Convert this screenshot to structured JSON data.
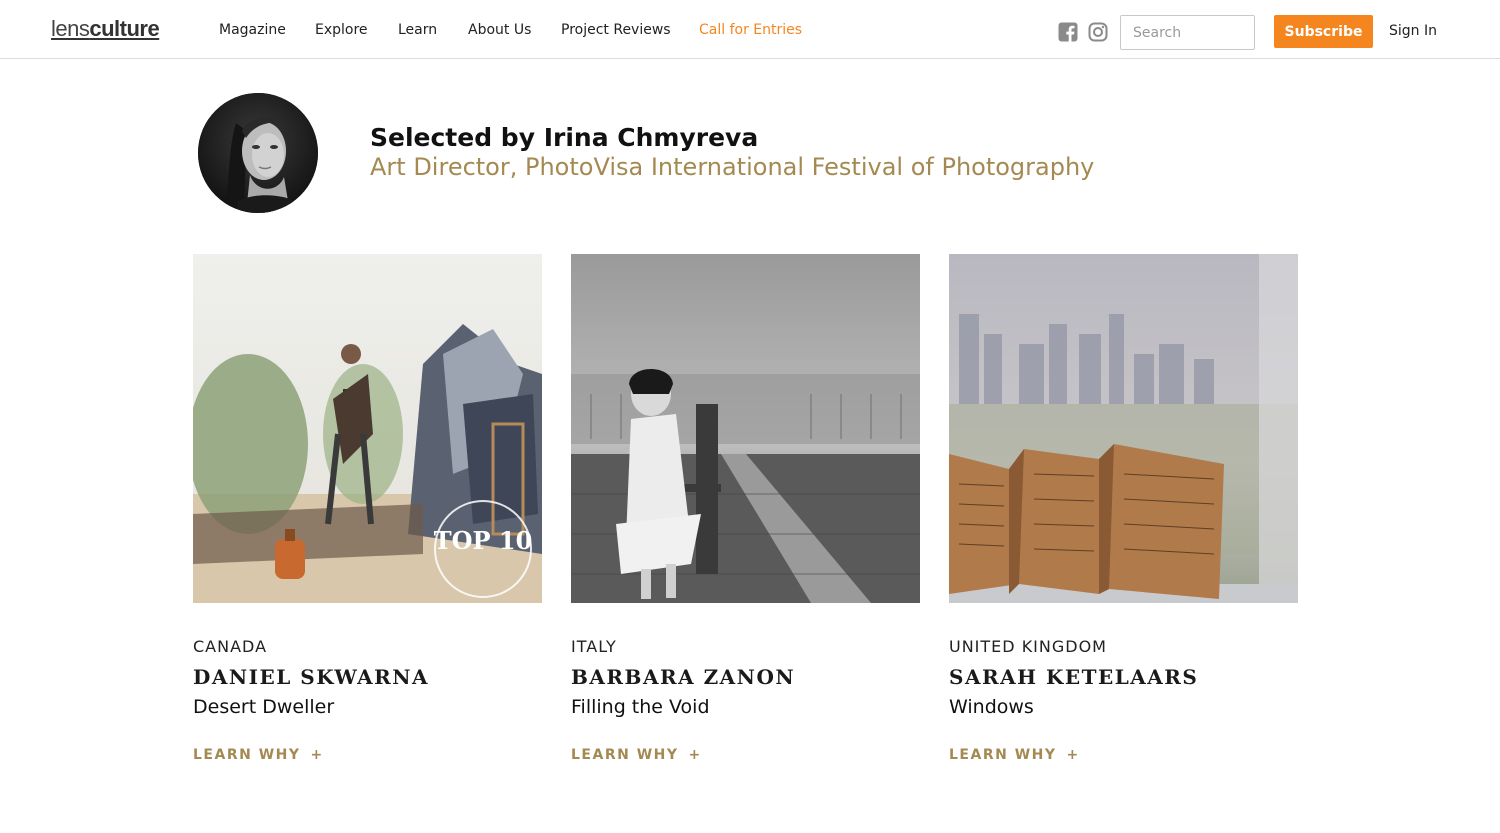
{
  "header": {
    "logo_light": "lens",
    "logo_bold": "culture",
    "nav": [
      {
        "label": "Magazine"
      },
      {
        "label": "Explore"
      },
      {
        "label": "Learn"
      },
      {
        "label": "About Us"
      },
      {
        "label": "Project Reviews"
      },
      {
        "label": "Call for Entries",
        "accent": true
      }
    ],
    "social_icons": [
      "facebook-icon",
      "instagram-icon"
    ],
    "search_placeholder": "Search",
    "subscribe_label": "Subscribe",
    "signin_label": "Sign In",
    "accent_color": "#f5861f"
  },
  "juror": {
    "name": "Selected by Irina Chmyreva",
    "role": "Art Director, PhotoVisa International Festival of Photography",
    "role_color": "#a48a52"
  },
  "cards": [
    {
      "country": "CANADA",
      "artist": "DANIEL SKWARNA",
      "project": "Desert Dweller",
      "learn": "LEARN WHY",
      "plus": "+",
      "badge_text": "TOP 10"
    },
    {
      "country": "ITALY",
      "artist": "BARBARA ZANON",
      "project": "Filling the Void",
      "learn": "LEARN WHY",
      "plus": "+"
    },
    {
      "country": "UNITED KINGDOM",
      "artist": "SARAH KETELAARS",
      "project": "Windows",
      "learn": "LEARN WHY",
      "plus": "+"
    }
  ]
}
